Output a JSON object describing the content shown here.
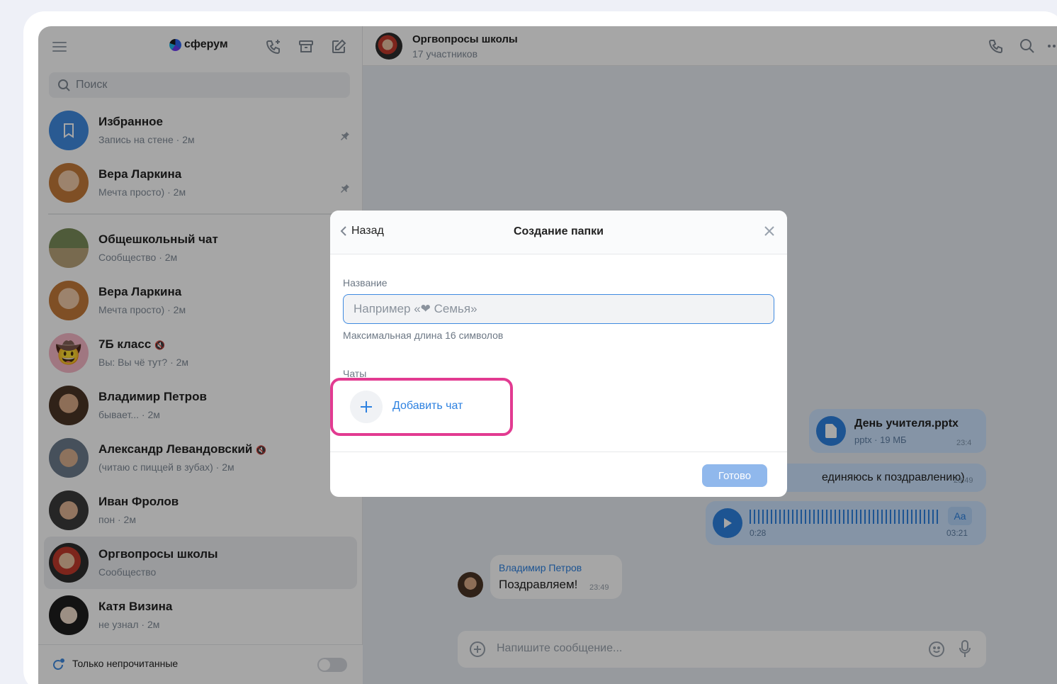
{
  "sidebar": {
    "brand": "сферум",
    "search_placeholder": "Поиск",
    "chats": [
      {
        "name": "Избранное",
        "sub": "Запись на стене · 2м",
        "pinned": true
      },
      {
        "name": "Вера Ларкина",
        "sub": "Мечта просто) · 2м",
        "pinned": true
      },
      {
        "name": "Общешкольный чат",
        "sub": "Сообщество · 2м"
      },
      {
        "name": "Вера Ларкина",
        "sub": "Мечта просто) · 2м"
      },
      {
        "name": "7Б класс",
        "sub": "Вы: Вы чё тут? · 2м"
      },
      {
        "name": "Владимир Петров",
        "sub": "бывает... · 2м"
      },
      {
        "name": "Александр Левандовский",
        "sub": "(читаю с пиццей в зубах) · 2м"
      },
      {
        "name": "Иван Фролов",
        "sub": "пон · 2м"
      },
      {
        "name": "Оргвопросы школы",
        "sub": "Сообщество",
        "active": true
      },
      {
        "name": "Катя Визина",
        "sub": "не узнал · 2м"
      }
    ],
    "footer_label": "Только непрочитанные"
  },
  "main": {
    "title": "Оргвопросы школы",
    "subtitle": "17 участников",
    "file_name": "День учителя.pptx",
    "file_meta": "pptx · 19 МБ",
    "file_time": "23:4",
    "msg_text": "единяюсь к поздравлению)",
    "msg_time": "23:49",
    "voice_start": "0:28",
    "voice_end": "03:21",
    "voice_aa": "Aa",
    "in_author": "Владимир Петров",
    "in_text": "Поздравляем!",
    "in_time": "23:49",
    "composer_placeholder": "Напишите сообщение..."
  },
  "modal": {
    "back_label": "Назад",
    "title": "Создание папки",
    "name_label": "Название",
    "name_placeholder": "Например «❤ Семья»",
    "hint": "Максимальная длина 16 символов",
    "chats_label": "Чаты",
    "add_chat_label": "Добавить чат",
    "done_label": "Готово"
  },
  "colors": {
    "accent": "#2d81e0",
    "highlight": "#e23b91"
  }
}
